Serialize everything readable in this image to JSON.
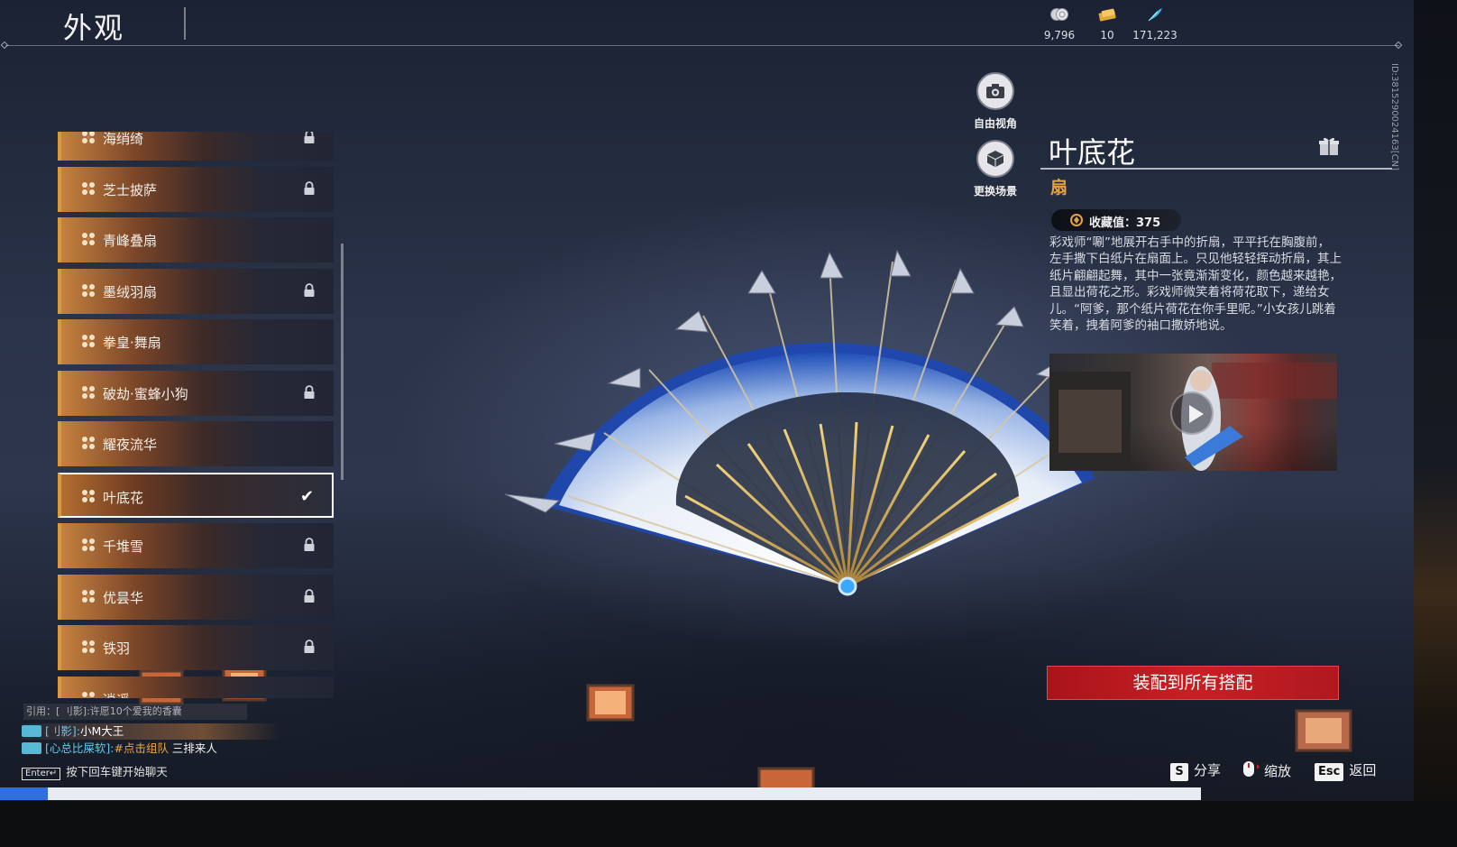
{
  "header": {
    "title": "外观",
    "currencies": [
      {
        "icon": "silver-coin-icon",
        "value": "9,796"
      },
      {
        "icon": "ticket-icon",
        "value": "10"
      },
      {
        "icon": "feather-icon",
        "value": "171,223"
      }
    ]
  },
  "side_id": "ID:3815290024163[CN]",
  "camera": {
    "free_view": "自由视角",
    "change_scene": "更换场景"
  },
  "items": [
    {
      "name": "海绡绮",
      "locked": true
    },
    {
      "name": "芝士披萨",
      "locked": true
    },
    {
      "name": "青峰叠扇",
      "locked": false
    },
    {
      "name": "墨绒羽扇",
      "locked": true
    },
    {
      "name": "拳皇·舞扇",
      "locked": false
    },
    {
      "name": "破劫·蜜蜂小狗",
      "locked": true
    },
    {
      "name": "耀夜流华",
      "locked": false
    },
    {
      "name": "叶底花",
      "locked": false,
      "selected": true
    },
    {
      "name": "千堆雪",
      "locked": true
    },
    {
      "name": "优昙华",
      "locked": true
    },
    {
      "name": "铁羽",
      "locked": true
    },
    {
      "name": "逍遥",
      "locked": false
    }
  ],
  "detail": {
    "name": "叶底花",
    "type": "扇",
    "collection_label": "收藏值：375",
    "description": "彩戏师“唰”地展开右手中的折扇，平平托在胸腹前，左手撒下白纸片在扇面上。只见他轻轻挥动折扇，其上纸片翩翩起舞，其中一张竟渐渐变化，颜色越来越艳，且显出荷花之形。彩戏师微笑着将荷花取下，递给女儿。“阿爹，那个纸片荷花在你手里呢。”小女孩儿跳着笑着，拽着阿爹的袖口撒娇地说。",
    "equip_button": "装配到所有搭配"
  },
  "chat": {
    "quote": "引用：[ 刂影]:许愿10个爱我的香囊",
    "line1_channel": "[刂影]:",
    "line1_user": "小M大王",
    "line2_channel": "[心总比屎软]:",
    "line2_highlight": "#点击组队",
    "line2_msg": " 三排来人",
    "enter_key": "Enter↵",
    "enter_hint": "按下回车键开始聊天"
  },
  "hints": {
    "share_key": "S",
    "share": "分享",
    "zoom": "缩放",
    "back_key": "Esc",
    "back": "返回"
  },
  "colors": {
    "accent_gold": "#e6a23f",
    "equip_red": "#c72024",
    "chat_cyan": "#66c8ea"
  },
  "progress": 0.04
}
